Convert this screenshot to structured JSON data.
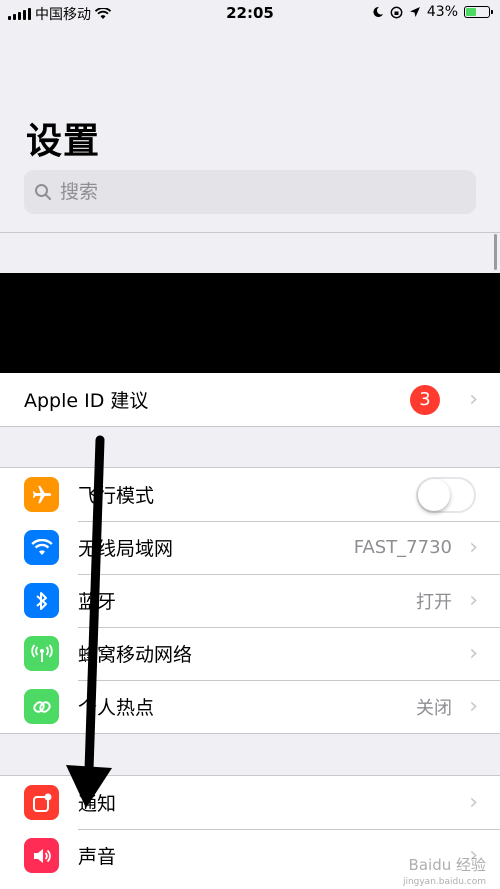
{
  "status_bar": {
    "carrier": "中国移动",
    "time": "22:05",
    "battery": "43%",
    "battery_level": 0.43
  },
  "title": "设置",
  "search": {
    "placeholder": "搜索"
  },
  "apple_id_row": {
    "label": "Apple ID 建议",
    "badge": "3"
  },
  "group1": [
    {
      "label": "飞行模式",
      "icon": "airplane-icon",
      "color": "#ff9500",
      "toggle": false
    },
    {
      "label": "无线局域网",
      "icon": "wifi-icon",
      "color": "#007aff",
      "value": "FAST_7730"
    },
    {
      "label": "蓝牙",
      "icon": "bluetooth-icon",
      "color": "#007aff",
      "value": "打开"
    },
    {
      "label": "蜂窝移动网络",
      "icon": "cellular-icon",
      "color": "#4cd964",
      "value": ""
    },
    {
      "label": "个人热点",
      "icon": "hotspot-icon",
      "color": "#4cd964",
      "value": "关闭"
    }
  ],
  "group2": [
    {
      "label": "通知",
      "icon": "notifications-icon",
      "color": "#ff3b30"
    },
    {
      "label": "声音",
      "icon": "sounds-icon",
      "color": "#ff2d55"
    }
  ],
  "watermark": {
    "text": "Baidu 经验",
    "sub": "jingyan.baidu.com"
  }
}
